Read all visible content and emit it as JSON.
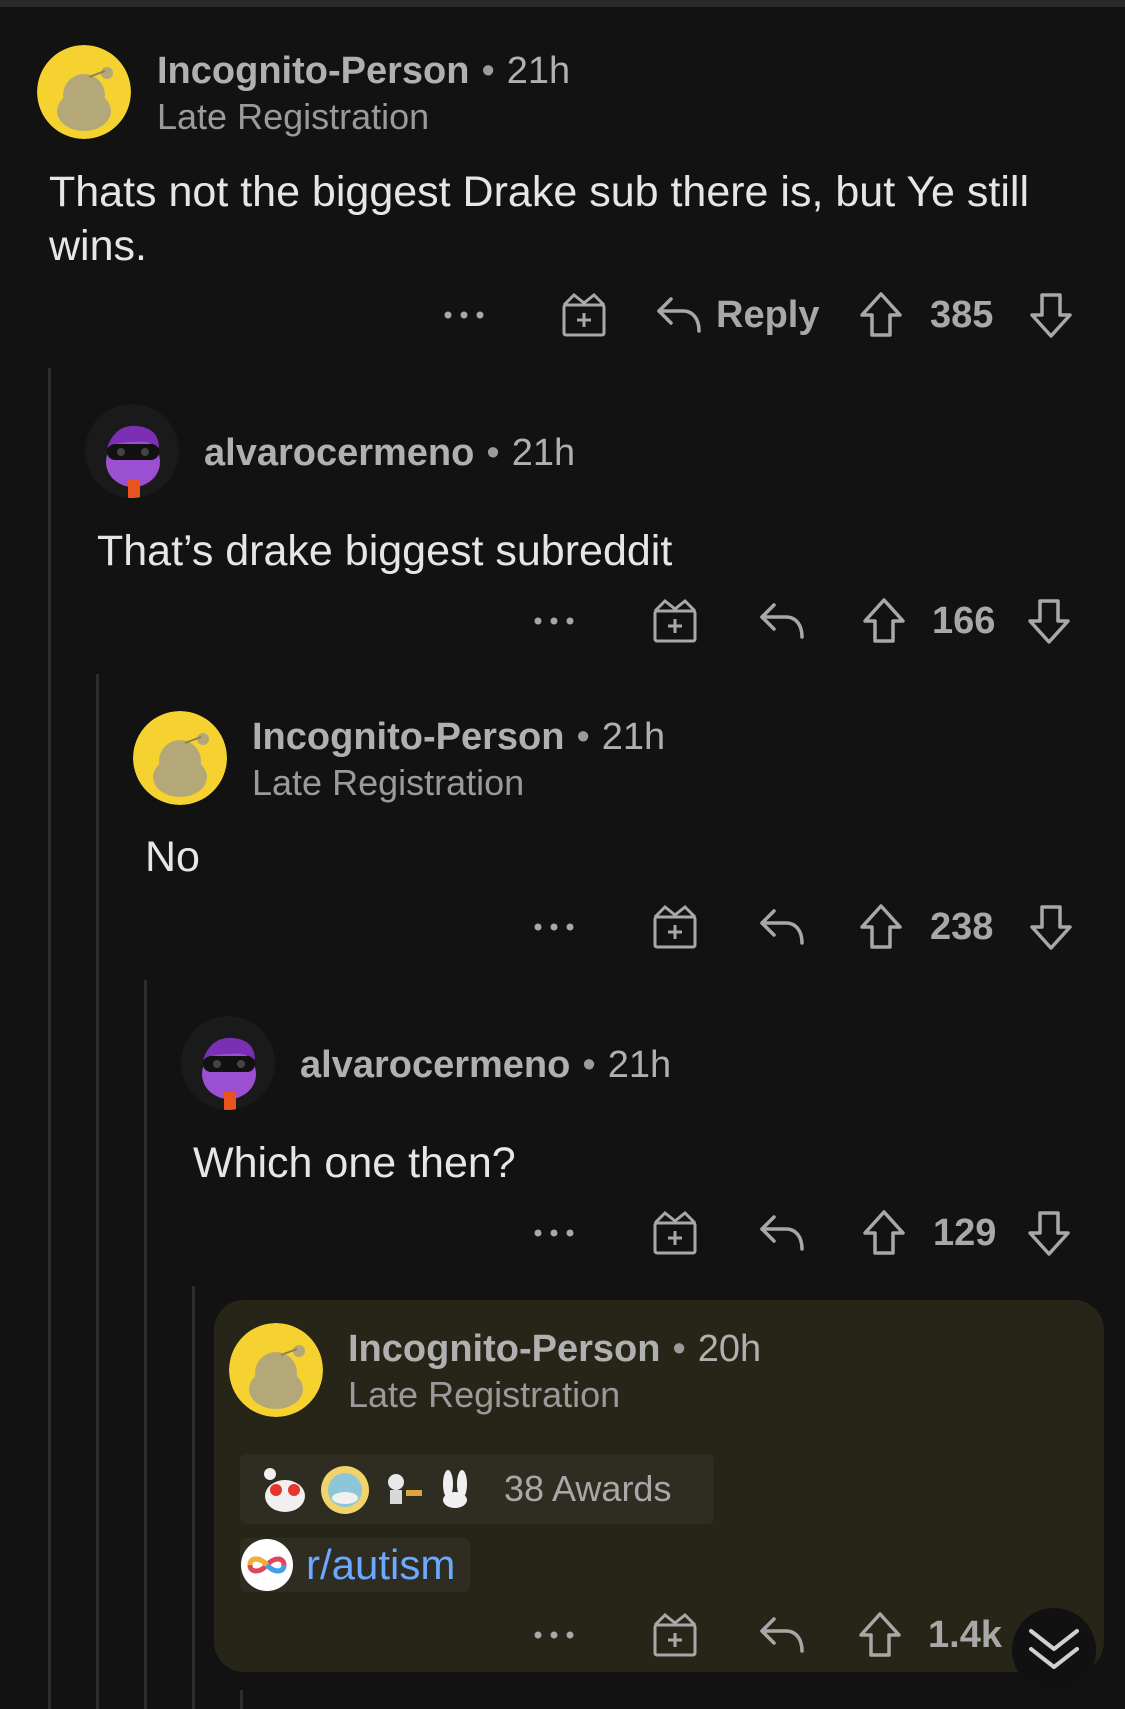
{
  "comments": [
    {
      "username": "Incognito-Person",
      "time": "21h",
      "flair": "Late Registration",
      "body": "Thats not the biggest Drake sub there is, but Ye still wins.",
      "score": "385",
      "reply_label": "Reply"
    },
    {
      "username": "alvarocermeno",
      "time": "21h",
      "flair": "",
      "body": "That’s drake biggest subreddit",
      "score": "166"
    },
    {
      "username": "Incognito-Person",
      "time": "21h",
      "flair": "Late Registration",
      "body": "No",
      "score": "238"
    },
    {
      "username": "alvarocermeno",
      "time": "21h",
      "flair": "",
      "body": "Which one then?",
      "score": "129"
    },
    {
      "username": "Incognito-Person",
      "time": "20h",
      "flair": "Late Registration",
      "awards": "38 Awards",
      "subreddit_link": "r/autism",
      "score": "1.4k"
    }
  ],
  "separator": "•",
  "more_glyph": "•••",
  "colors": {
    "background": "#121212",
    "highlight": "#272418",
    "link": "#6ba8ff",
    "avatar_yellow": "#f5d230"
  },
  "icons": [
    "snoo-avatar",
    "purple-snoo-avatar",
    "more-icon",
    "gift-award-icon",
    "reply-icon",
    "upvote-icon",
    "downvote-icon",
    "chevron-down-icon"
  ]
}
